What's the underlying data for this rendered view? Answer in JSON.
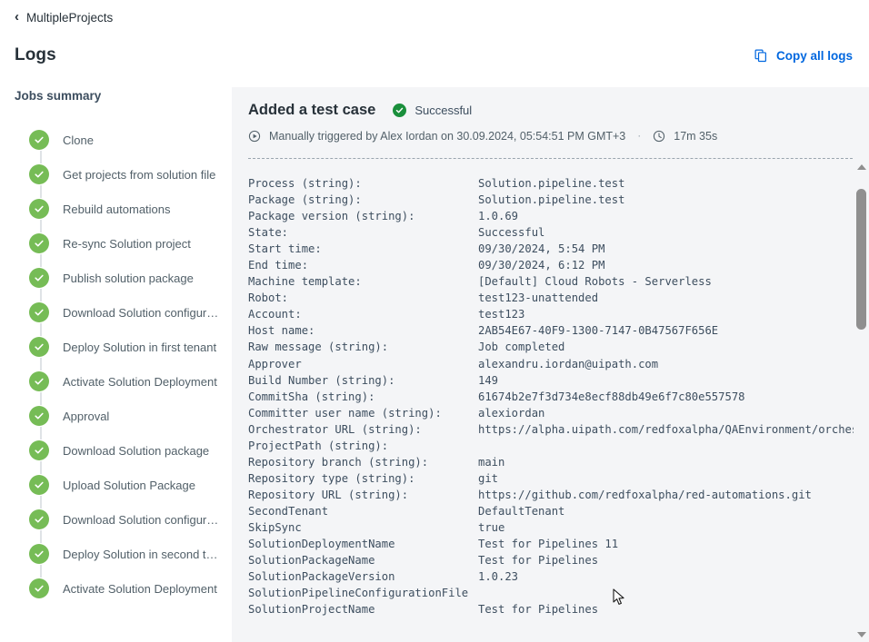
{
  "breadcrumb": {
    "back_icon": "chevron-left-icon",
    "label": "MultipleProjects"
  },
  "header": {
    "title": "Logs",
    "copy_button": {
      "label": "Copy all logs",
      "icon": "copy-icon",
      "color": "#0067df"
    }
  },
  "sidebar": {
    "title": "Jobs summary",
    "items": [
      {
        "label": "Clone",
        "status": "success"
      },
      {
        "label": "Get projects from solution file",
        "status": "success"
      },
      {
        "label": "Rebuild automations",
        "status": "success"
      },
      {
        "label": "Re-sync Solution project",
        "status": "success"
      },
      {
        "label": "Publish solution package",
        "status": "success"
      },
      {
        "label": "Download Solution configurat...",
        "status": "success"
      },
      {
        "label": "Deploy Solution in first tenant",
        "status": "success"
      },
      {
        "label": "Activate Solution Deployment",
        "status": "success"
      },
      {
        "label": "Approval",
        "status": "success"
      },
      {
        "label": "Download Solution package",
        "status": "success"
      },
      {
        "label": "Upload Solution Package",
        "status": "success"
      },
      {
        "label": "Download Solution configurat...",
        "status": "success"
      },
      {
        "label": "Deploy Solution in second ten...",
        "status": "success"
      },
      {
        "label": "Activate Solution Deployment",
        "status": "success"
      }
    ],
    "success_color": "#76bc56"
  },
  "job": {
    "name": "Added a test case",
    "status_label": "Successful",
    "status_icon": "check-circle-icon",
    "status_color": "#1a8f3c",
    "trigger_icon": "play-circle-icon",
    "trigger_text": "Manually triggered by Alex Iordan on 30.09.2024, 05:54:51 PM GMT+3",
    "separator": "·",
    "duration_icon": "clock-icon",
    "duration": "17m 35s"
  },
  "log": {
    "lines": [
      {
        "key": "Process (string):",
        "value": "Solution.pipeline.test"
      },
      {
        "key": "Package (string):",
        "value": "Solution.pipeline.test"
      },
      {
        "key": "Package version (string):",
        "value": "1.0.69"
      },
      {
        "key": "State:",
        "value": "Successful"
      },
      {
        "key": "Start time:",
        "value": "09/30/2024, 5:54 PM"
      },
      {
        "key": "End time:",
        "value": "09/30/2024, 6:12 PM"
      },
      {
        "key": "Machine template:",
        "value": "[Default] Cloud Robots - Serverless"
      },
      {
        "key": "Robot:",
        "value": "test123-unattended"
      },
      {
        "key": "Account:",
        "value": "test123"
      },
      {
        "key": "Host name:",
        "value": "2AB54E67-40F9-1300-7147-0B47567F656E"
      },
      {
        "key": "Raw message (string):",
        "value": "Job completed"
      },
      {
        "key": "Approver",
        "value": "alexandru.iordan@uipath.com"
      },
      {
        "key": "Build Number (string):",
        "value": "149"
      },
      {
        "key": "CommitSha (string):",
        "value": "61674b2e7f3d734e8ecf88db49e6f7c80e557578"
      },
      {
        "key": "Committer user name (string):",
        "value": "alexiordan"
      },
      {
        "key": "Orchestrator URL (string):",
        "value": "https://alpha.uipath.com/redfoxalpha/QAEnvironment/orchestrator_"
      },
      {
        "key": "ProjectPath (string):",
        "value": ""
      },
      {
        "key": "Repository branch (string):",
        "value": "main"
      },
      {
        "key": "Repository type (string):",
        "value": "git"
      },
      {
        "key": "Repository URL (string):",
        "value": "https://github.com/redfoxalpha/red-automations.git"
      },
      {
        "key": "SecondTenant",
        "value": "DefaultTenant"
      },
      {
        "key": "SkipSync",
        "value": "true"
      },
      {
        "key": "SolutionDeploymentName",
        "value": "Test for Pipelines 11"
      },
      {
        "key": "SolutionPackageName",
        "value": "Test for Pipelines"
      },
      {
        "key": "SolutionPackageVersion",
        "value": "1.0.23"
      },
      {
        "key": "SolutionPipelineConfigurationFile",
        "value": ""
      },
      {
        "key": "SolutionProjectName",
        "value": "Test for Pipelines"
      }
    ]
  },
  "scrollbar": {
    "up_icon": "scroll-up-arrow-icon",
    "down_icon": "scroll-down-arrow-icon",
    "thumb": "scroll-thumb"
  }
}
